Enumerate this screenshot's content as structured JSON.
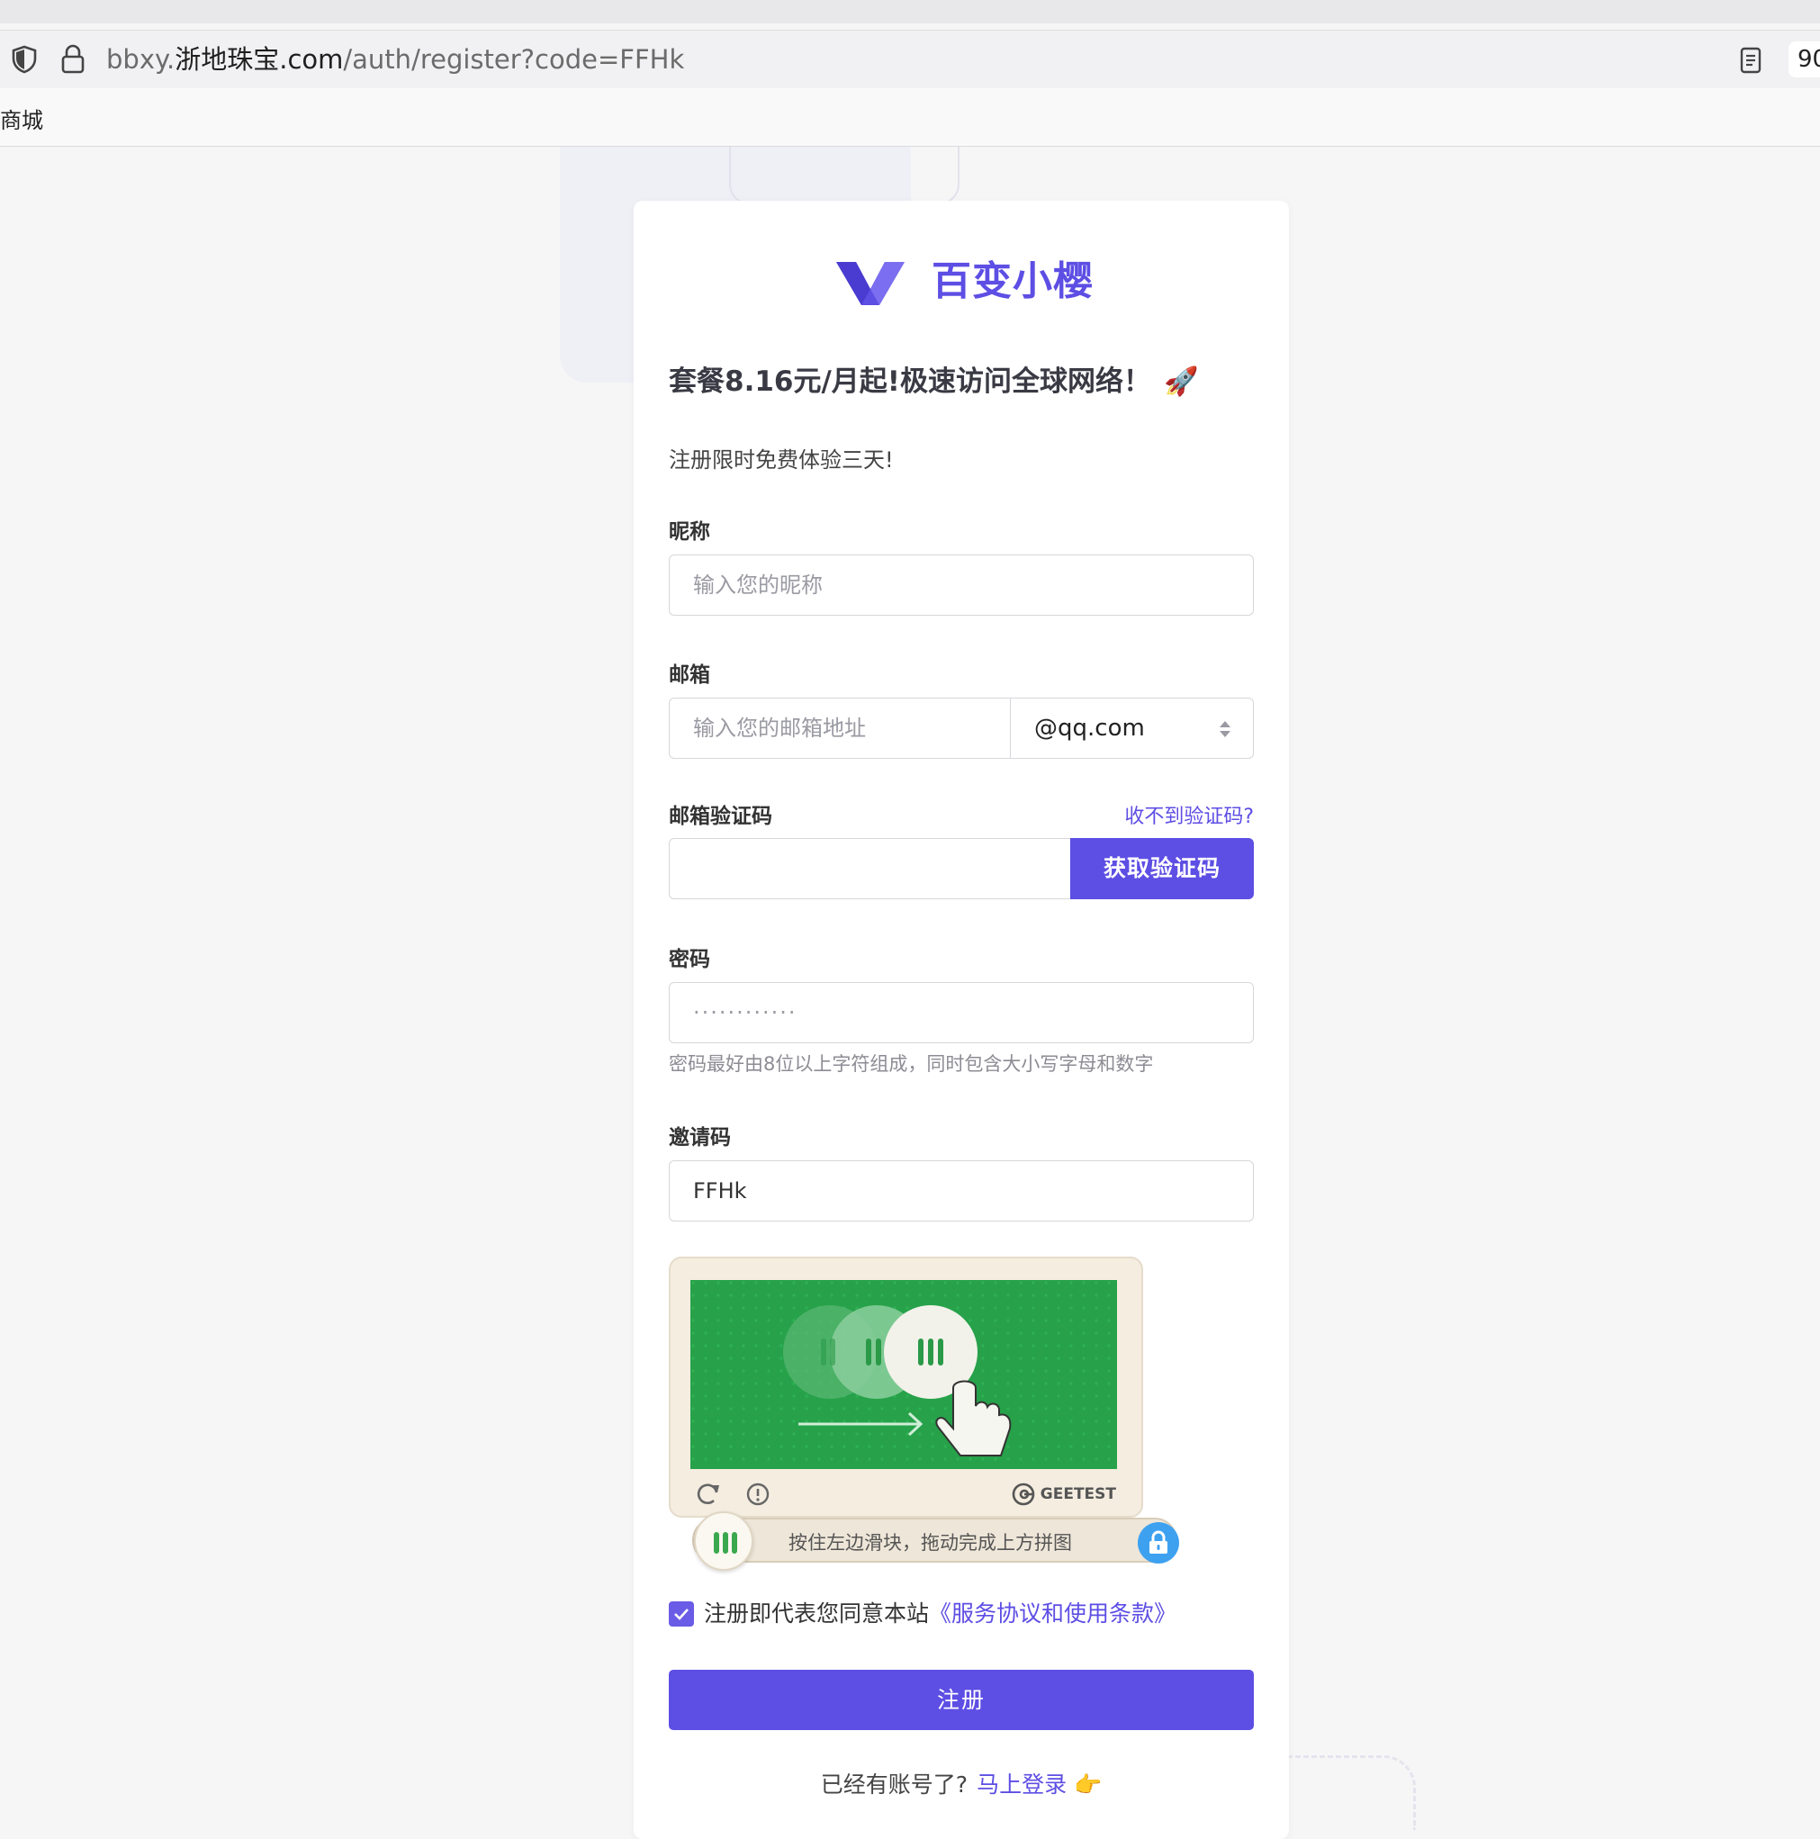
{
  "browser": {
    "url_prefix": "bbxy.",
    "url_host": "浙地珠宝.com",
    "url_path": "/auth/register?code=FFHk",
    "zoom": "90",
    "bookmark": "商城"
  },
  "brand": {
    "name": "百变小樱",
    "accent": "#5d4ee4"
  },
  "promo": {
    "headline": "套餐8.16元/月起!极速访问全球网络！",
    "headline_emoji": "🚀",
    "subline": "注册限时免费体验三天!"
  },
  "form": {
    "nickname": {
      "label": "昵称",
      "placeholder": "输入您的昵称"
    },
    "email": {
      "label": "邮箱",
      "placeholder": "输入您的邮箱地址",
      "domain": "@qq.com"
    },
    "email_code": {
      "label": "邮箱验证码",
      "help_link": "收不到验证码?",
      "button": "获取验证码"
    },
    "password": {
      "label": "密码",
      "value": "············",
      "hint": "密码最好由8位以上字符组成，同时包含大小写字母和数字"
    },
    "invite": {
      "label": "邀请码",
      "value": "FFHk"
    },
    "captcha": {
      "brand": "GEETEST",
      "slider_text": "按住左边滑块，拖动完成上方拼图"
    },
    "agreement": {
      "text": "注册即代表您同意本站",
      "link": "《服务协议和使用条款》",
      "checked": true
    },
    "submit": "注册",
    "login_prompt": "已经有账号了?",
    "login_link": "马上登录",
    "login_emoji": "👉"
  }
}
